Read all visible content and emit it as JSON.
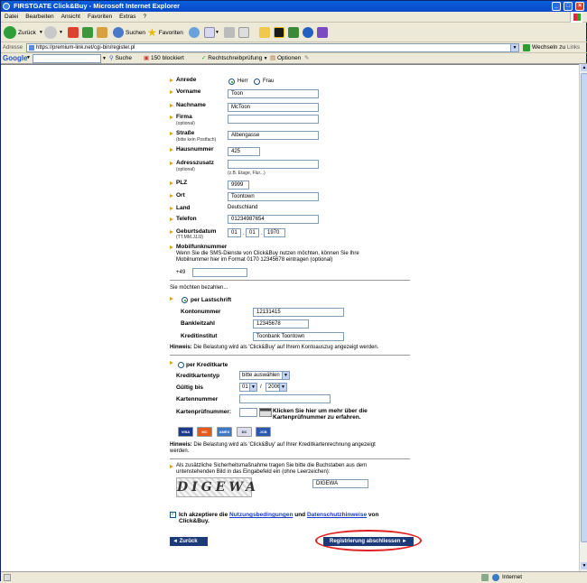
{
  "window": {
    "title": "FIRSTGATE Click&Buy - Microsoft Internet Explorer"
  },
  "menu": [
    "Datei",
    "Bearbeiten",
    "Ansicht",
    "Favoriten",
    "Extras",
    "?"
  ],
  "toolbar": {
    "back_label": "Zurück",
    "search_label": "Suchen",
    "favorites_label": "Favoriten"
  },
  "address": {
    "label": "Adresse",
    "url": "https://premium-link.net/cgi-bin/register.pl",
    "go_label": "Wechseln zu",
    "links_label": "Links"
  },
  "google_bar": {
    "logo": "Google",
    "search_label": "Suche",
    "blocked_label": "150 blockiert",
    "spell_label": "Rechtschreibprüfung",
    "options_label": "Optionen"
  },
  "form": {
    "anrede_label": "Anrede",
    "anrede_herr": "Herr",
    "anrede_frau": "Frau",
    "vorname_label": "Vorname",
    "vorname_value": "Toon",
    "nachname_label": "Nachname",
    "nachname_value": "McToon",
    "firma_label": "Firma",
    "firma_sub": "(optional)",
    "firma_value": "",
    "strasse_label": "Straße",
    "strasse_sub": "(bitte kein Postfach)",
    "strasse_value": "Albengasse",
    "hausnummer_label": "Hausnummer",
    "hausnummer_value": "425",
    "adresszusatz_label": "Adresszusatz",
    "adresszusatz_sub": "(optional)",
    "adresszusatz_hint": "(z.B. Etage, Flur...)",
    "plz_label": "PLZ",
    "plz_value": "9999",
    "ort_label": "Ort",
    "ort_value": "Toontown",
    "land_label": "Land",
    "land_value": "Deutschland",
    "telefon_label": "Telefon",
    "telefon_value": "01234987654",
    "geburtsdatum_label": "Geburtsdatum",
    "geburtsdatum_sub": "(TT.MM.JJJJ)",
    "geb_tag": "01",
    "geb_monat": "01",
    "geb_jahr": "1970",
    "mobil_label": "Mobilfunknummer",
    "mobil_text1": "Wenn Sie die SMS-Dienste von Click&Buy nutzen möchten, können Sie Ihre",
    "mobil_text2": "Mobilnummer hier im Format 0170 12345678 eintragen (optional)",
    "mobil_prefix": "+49",
    "mobil_value": ""
  },
  "payment": {
    "intro": "Sie möchten bezahlen...",
    "lastschrift_label": "per Lastschrift",
    "kontonummer_label": "Kontonummer",
    "kontonummer_value": "12131415",
    "blz_label": "Bankleitzahl",
    "blz_value": "12345678",
    "kreditinstitut_label": "Kreditinstitut",
    "kreditinstitut_value": "Toonbank Toontown",
    "hinweis_bold": "Hinweis:",
    "lastschrift_hinweis": "Die Belastung wird als 'Click&Buy' auf Ihrem Kontoauszug angezeigt werden.",
    "kredit_label": "per Kreditkarte",
    "kartentyp_label": "Kreditkartentyp",
    "kartentyp_value": "bitte auswählen",
    "gueltig_label": "Gültig bis",
    "gueltig_monat": "01",
    "gueltig_jahr": "2006",
    "gueltig_sep": "/",
    "kartennummer_label": "Kartennummer",
    "kartennummer_value": "",
    "pruefnummer_label": "Kartenprüfnummer:",
    "pruefnummer_value": "",
    "pruef_info1": "Klicken Sie hier um mehr über die",
    "pruef_info2": "Kartenprüfnummer zu erfahren.",
    "cards": [
      "VISA",
      "MC",
      "AMEX",
      "DC",
      "JCB"
    ],
    "kredit_hinweis1": "Die Belastung wird als 'Click&Buy' auf Ihrer Kreditkartenrechnung angezeigt",
    "kredit_hinweis2": "werden."
  },
  "captcha": {
    "text1": "Als zusätzliche Sicherheitsmaßnahme tragen Sie bitte die Buchstaben aus dem",
    "text2": "untenstehenden Bild in das Eingabefeld ein (ohne Leerzeichen):",
    "image_text": "DIGEWA",
    "value": "DIGEWA"
  },
  "agree": {
    "pre": "Ich akzeptiere die",
    "link1": "Nutzungsbedingungen",
    "mid": "und",
    "link2": "Datenschutzhinweise",
    "post": "von",
    "line2": "Click&Buy."
  },
  "buttons": {
    "back": "◄ Zurück",
    "submit": "Registrierung abschliessen ►"
  },
  "status": {
    "zone": "Internet"
  },
  "colors": {
    "accent": "#e0a020",
    "button": "#1d3a78",
    "highlight": "#e02020",
    "link": "#1a3ccc"
  }
}
